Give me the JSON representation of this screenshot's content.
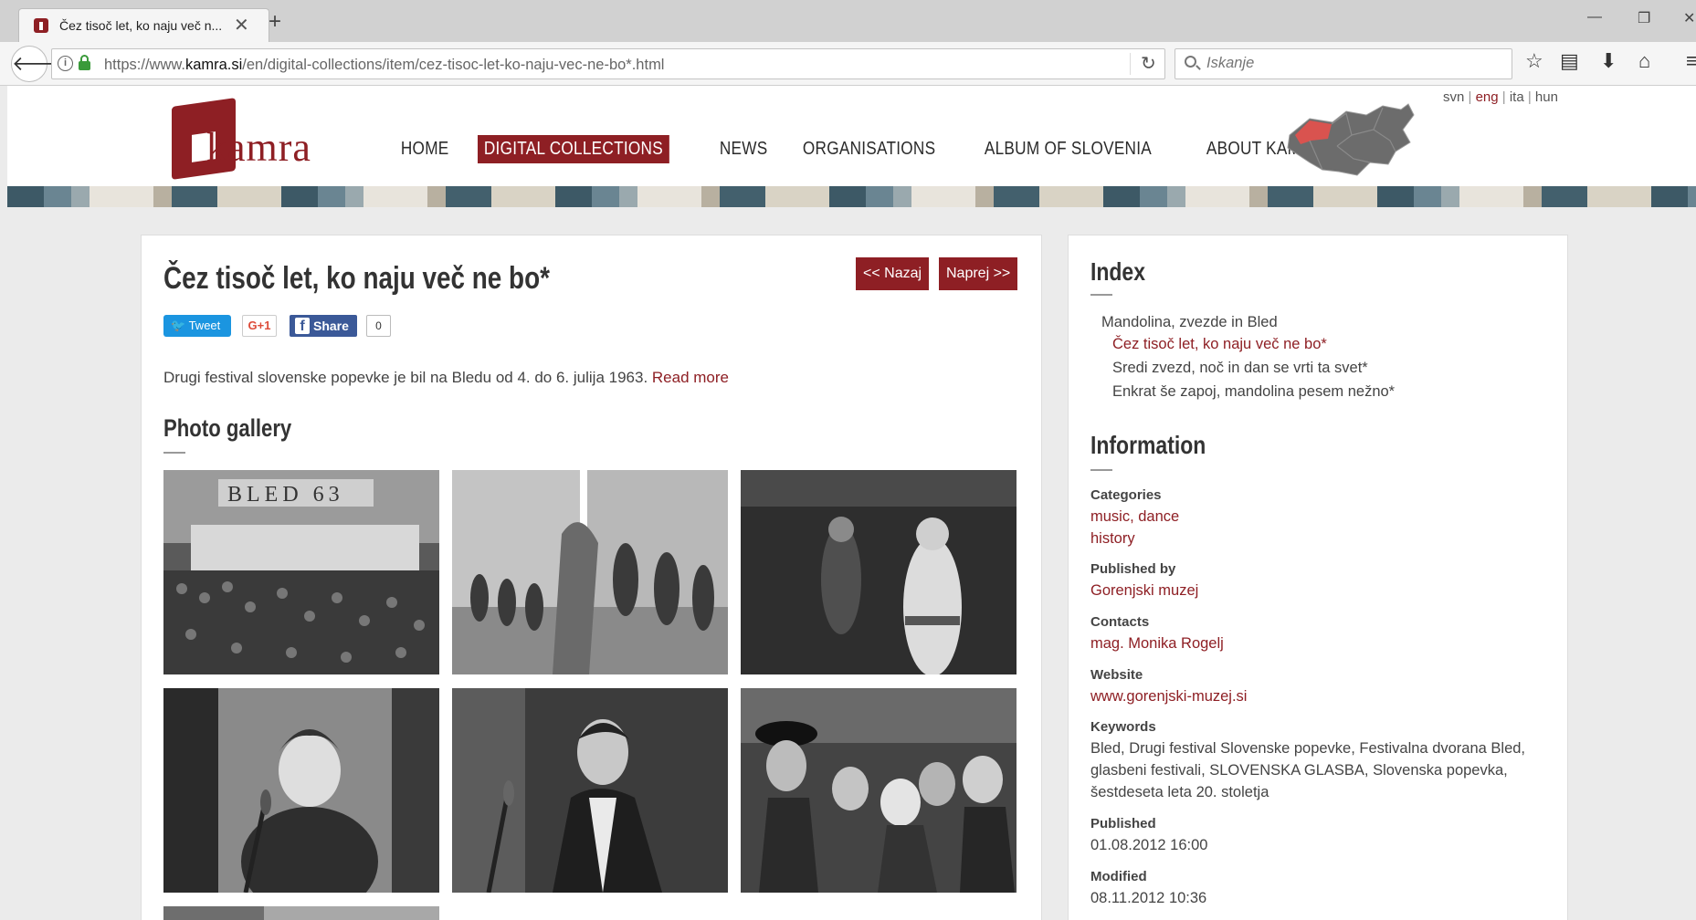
{
  "browser": {
    "tab_title": "Čez tisoč let, ko naju več n...",
    "url_prefix": "https://www.",
    "url_domain": "kamra.si",
    "url_path": "/en/digital-collections/item/cez-tisoc-let-ko-naju-vec-ne-bo*.html",
    "search_placeholder": "Iskanje"
  },
  "site": {
    "logo_text": "kamra",
    "nav": [
      "HOME",
      "DIGITAL COLLECTIONS",
      "NEWS",
      "ORGANISATIONS",
      "ALBUM OF SLOVENIA",
      "ABOUT KAMRA"
    ],
    "nav_active_index": 1,
    "languages": [
      "svn",
      "eng",
      "ita",
      "hun"
    ],
    "language_active": "eng",
    "accent_color": "#8e1f24"
  },
  "item": {
    "title": "Čez tisoč let, ko naju več ne bo*",
    "back_label": "<< Nazaj",
    "next_label": "Naprej >>",
    "share": {
      "tweet_label": "Tweet",
      "gplus_label": "G+1",
      "fb_label": "Share",
      "fb_count": "0"
    },
    "intro": "Drugi festival slovenske popevke je bil na Bledu od 4. do 6. julija 1963. ",
    "read_more": "Read more",
    "gallery_heading": "Photo gallery",
    "gallery_banner_text": "BLED 63"
  },
  "sidebar": {
    "index_heading": "Index",
    "index_parent": "Mandolina, zvezde in Bled",
    "index_items": [
      {
        "label": "Čez tisoč let, ko naju več ne bo*",
        "current": true
      },
      {
        "label": "Sredi zvezd, noč in dan se vrti ta svet*",
        "current": false
      },
      {
        "label": "Enkrat še zapoj, mandolina pesem nežno*",
        "current": false
      }
    ],
    "info_heading": "Information",
    "categories_label": "Categories",
    "categories_line1": "music, dance",
    "categories_line2": "history",
    "published_by_label": "Published by",
    "published_by": "Gorenjski muzej",
    "contacts_label": "Contacts",
    "contacts": "mag. Monika Rogelj",
    "website_label": "Website",
    "website": "www.gorenjski-muzej.si",
    "keywords_label": "Keywords",
    "keywords_line1": "Bled, Drugi festival Slovenske popevke, Festivalna dvorana Bled,",
    "keywords_line2": "glasbeni festivali, SLOVENSKA GLASBA, Slovenska popevka,",
    "keywords_line3": "šestdeseta leta 20. stoletja",
    "published_label": "Published",
    "published": "01.08.2012 16:00",
    "modified_label": "Modified",
    "modified": "08.11.2012 10:36"
  }
}
